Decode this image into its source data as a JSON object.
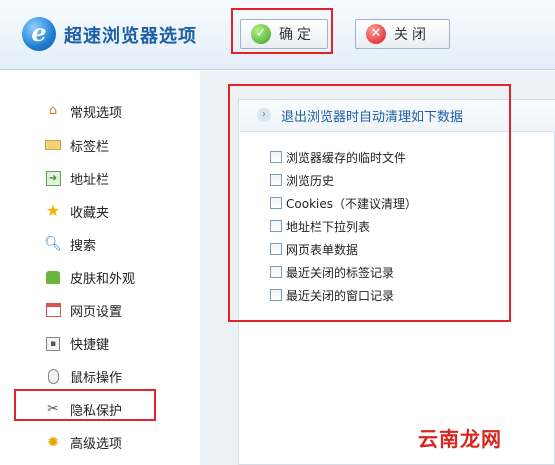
{
  "header": {
    "title": "超速浏览器选项",
    "logo_letter": "e",
    "ok_label": "确定",
    "close_label": "关闭"
  },
  "sidebar": {
    "items": [
      {
        "label": "常规选项",
        "icon": "home-icon"
      },
      {
        "label": "标签栏",
        "icon": "tab-icon"
      },
      {
        "label": "地址栏",
        "icon": "address-icon"
      },
      {
        "label": "收藏夹",
        "icon": "star-icon"
      },
      {
        "label": "搜索",
        "icon": "search-icon"
      },
      {
        "label": "皮肤和外观",
        "icon": "shirt-icon"
      },
      {
        "label": "网页设置",
        "icon": "webpage-icon"
      },
      {
        "label": "快捷键",
        "icon": "shortcut-icon"
      },
      {
        "label": "鼠标操作",
        "icon": "mouse-icon"
      },
      {
        "label": "隐私保护",
        "icon": "tools-icon",
        "highlighted": true
      },
      {
        "label": "高级选项",
        "icon": "gear-icon"
      }
    ]
  },
  "panel": {
    "title": "退出浏览器时自动清理如下数据",
    "options": [
      {
        "label": "浏览器缓存的临时文件",
        "checked": false
      },
      {
        "label": "浏览历史",
        "checked": false
      },
      {
        "label": "Cookies（不建议清理）",
        "checked": false
      },
      {
        "label": "地址栏下拉列表",
        "checked": false
      },
      {
        "label": "网页表单数据",
        "checked": false
      },
      {
        "label": "最近关闭的标签记录",
        "checked": false
      },
      {
        "label": "最近关闭的窗口记录",
        "checked": false
      }
    ]
  },
  "watermark": "云南龙网",
  "colors": {
    "highlight": "#e2232a",
    "accent": "#1b5fa6",
    "sidebar_bg": "#ffffff",
    "panel_bg": "#eef1f4"
  }
}
